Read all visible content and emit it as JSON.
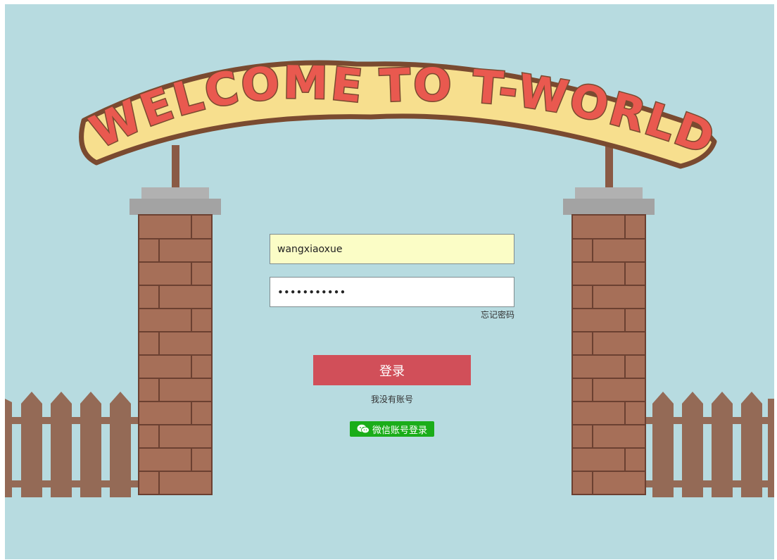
{
  "banner": {
    "text": "WELCOME TO T-WORLD"
  },
  "login": {
    "username_value": "wangxiaoxue",
    "password_value": "password123",
    "forgot_password": "忘记密码",
    "login_button": "登录",
    "register_link": "我没有账号",
    "wechat_login": "微信账号登录"
  },
  "colors": {
    "background": "#b7dbe0",
    "login_button": "#d14f59",
    "wechat_button": "#1aad19",
    "brick": "#a66f58",
    "fence": "#946a56"
  }
}
